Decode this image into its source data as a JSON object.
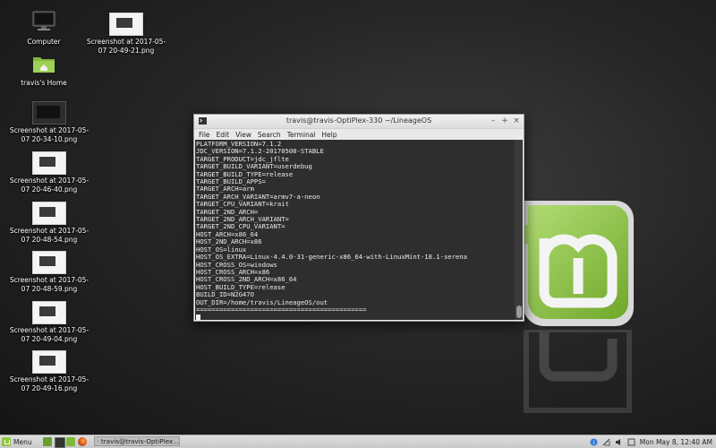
{
  "desktop": {
    "icons": [
      {
        "label": "Computer",
        "icon": "computer-icon"
      },
      {
        "label": "Screenshot at 2017-05-07 20-49-21.png",
        "icon": "image-file-icon"
      },
      {
        "label": "travis's Home",
        "icon": "home-folder-icon"
      },
      {
        "label": "Screenshot at 2017-05-07 20-34-10.png",
        "icon": "image-file-icon"
      },
      {
        "label": "Screenshot at 2017-05-07 20-46-40.png",
        "icon": "image-file-icon"
      },
      {
        "label": "Screenshot at 2017-05-07 20-48-54.png",
        "icon": "image-file-icon"
      },
      {
        "label": "Screenshot at 2017-05-07 20-48-59.png",
        "icon": "image-file-icon"
      },
      {
        "label": "Screenshot at 2017-05-07 20-49-04.png",
        "icon": "image-file-icon"
      },
      {
        "label": "Screenshot at 2017-05-07 20-49-16.png",
        "icon": "image-file-icon"
      }
    ]
  },
  "terminal": {
    "title": "travis@travis-OptiPlex-330 ~/LineageOS",
    "menu": [
      "File",
      "Edit",
      "View",
      "Search",
      "Terminal",
      "Help"
    ],
    "output": "PLATFORM_VERSION=7.1.2\nJDC_VERSION=7.1.2-20170508-STABLE\nTARGET_PRODUCT=jdc_jflte\nTARGET_BUILD_VARIANT=userdebug\nTARGET_BUILD_TYPE=release\nTARGET_BUILD_APPS=\nTARGET_ARCH=arm\nTARGET_ARCH_VARIANT=armv7-a-neon\nTARGET_CPU_VARIANT=krait\nTARGET_2ND_ARCH=\nTARGET_2ND_ARCH_VARIANT=\nTARGET_2ND_CPU_VARIANT=\nHOST_ARCH=x86_64\nHOST_2ND_ARCH=x86\nHOST_OS=linux\nHOST_OS_EXTRA=Linux-4.4.0-31-generic-x86_64-with-LinuxMint-18.1-serena\nHOST_CROSS_OS=windows\nHOST_CROSS_ARCH=x86\nHOST_CROSS_2ND_ARCH=x86_64\nHOST_BUILD_TYPE=release\nBUILD_ID=N2G47O\nOUT_DIR=/home/travis/LineageOS/out\n============================================",
    "buttons": {
      "minimize": "–",
      "maximize": "+",
      "close": "×"
    }
  },
  "panel": {
    "menu_label": "Menu",
    "task_label": "travis@travis-OptiPlex...",
    "clock": "Mon May  8, 12:40 AM"
  },
  "colors": {
    "mint_green": "#8fc63f",
    "terminal_bg": "#2e2e2e"
  }
}
